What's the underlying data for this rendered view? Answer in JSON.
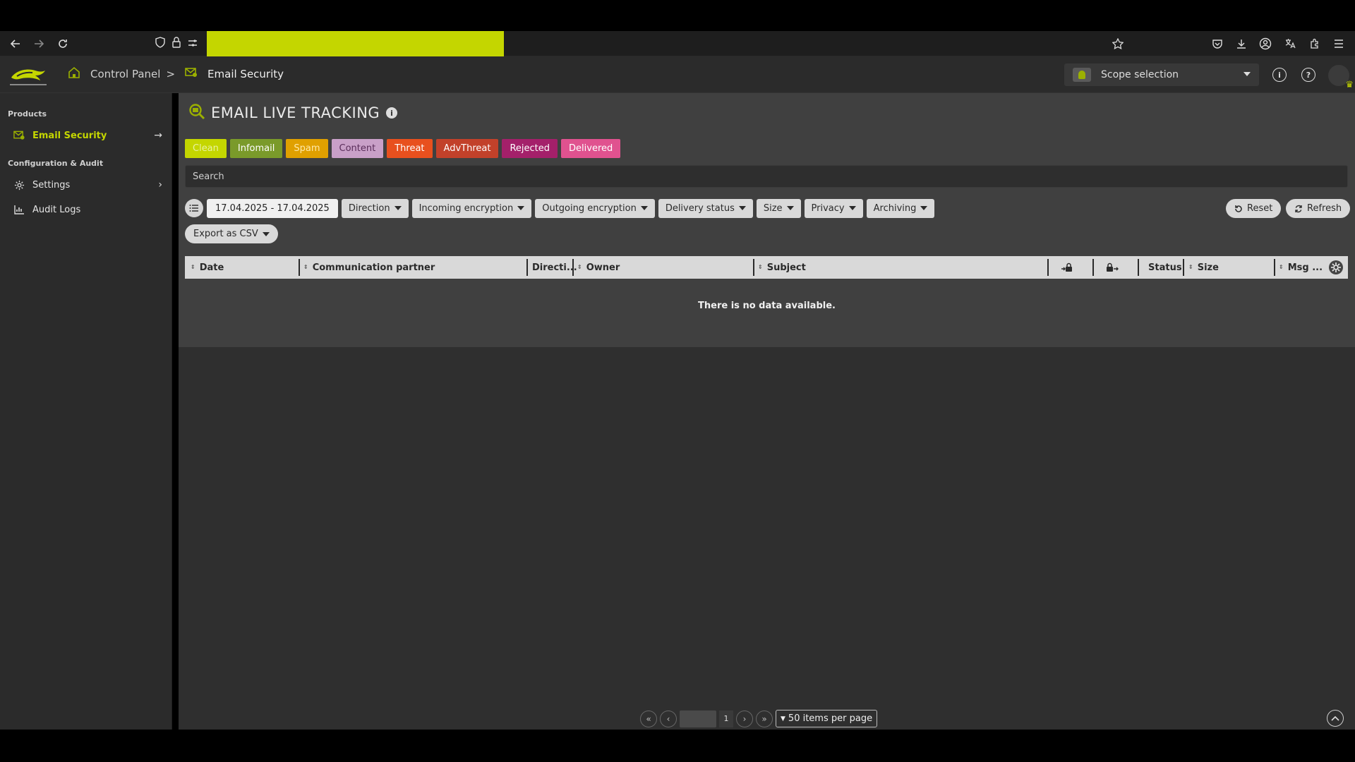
{
  "header": {
    "breadcrumb": [
      "Control Panel",
      "Email Security"
    ],
    "separator": ">",
    "scope_placeholder": "Scope selection"
  },
  "sidebar": {
    "sections": [
      {
        "title": "Products",
        "items": [
          {
            "label": "Email Security",
            "icon": "email-security-icon",
            "active": true
          }
        ]
      },
      {
        "title": "Configuration & Audit",
        "items": [
          {
            "label": "Settings",
            "icon": "gear-icon"
          },
          {
            "label": "Audit Logs",
            "icon": "chart-icon"
          }
        ]
      }
    ]
  },
  "page": {
    "title": "EMAIL LIVE TRACKING",
    "categories": [
      {
        "label": "Clean",
        "color": "#c4d600",
        "text": "#e9f2a0"
      },
      {
        "label": "Infomail",
        "color": "#7a9a2a",
        "text": "#ffffff"
      },
      {
        "label": "Spam",
        "color": "#e0a000",
        "text": "#ffe9a8"
      },
      {
        "label": "Content",
        "color": "#c9a0c8",
        "text": "#5a2d5a"
      },
      {
        "label": "Threat",
        "color": "#e8501e",
        "text": "#ffffff"
      },
      {
        "label": "AdvThreat",
        "color": "#c2412a",
        "text": "#ffffff"
      },
      {
        "label": "Rejected",
        "color": "#a4206a",
        "text": "#ffffff"
      },
      {
        "label": "Delivered",
        "color": "#e0528f",
        "text": "#ffffff"
      }
    ],
    "search_placeholder": "Search",
    "date_range": "17.04.2025 - 17.04.2025",
    "filters": [
      "Direction",
      "Incoming encryption",
      "Outgoing encryption",
      "Delivery status",
      "Size",
      "Privacy",
      "Archiving"
    ],
    "reset_label": "Reset",
    "refresh_label": "Refresh",
    "export_label": "Export as CSV",
    "columns": [
      "Date",
      "Communication partner",
      "Directi...",
      "Owner",
      "Subject",
      "",
      "",
      "Status",
      "Size",
      "Msg ..."
    ],
    "empty_message": "There is no data available.",
    "pager": {
      "total_pages": "1",
      "page_size_label": "50 items per page"
    }
  }
}
